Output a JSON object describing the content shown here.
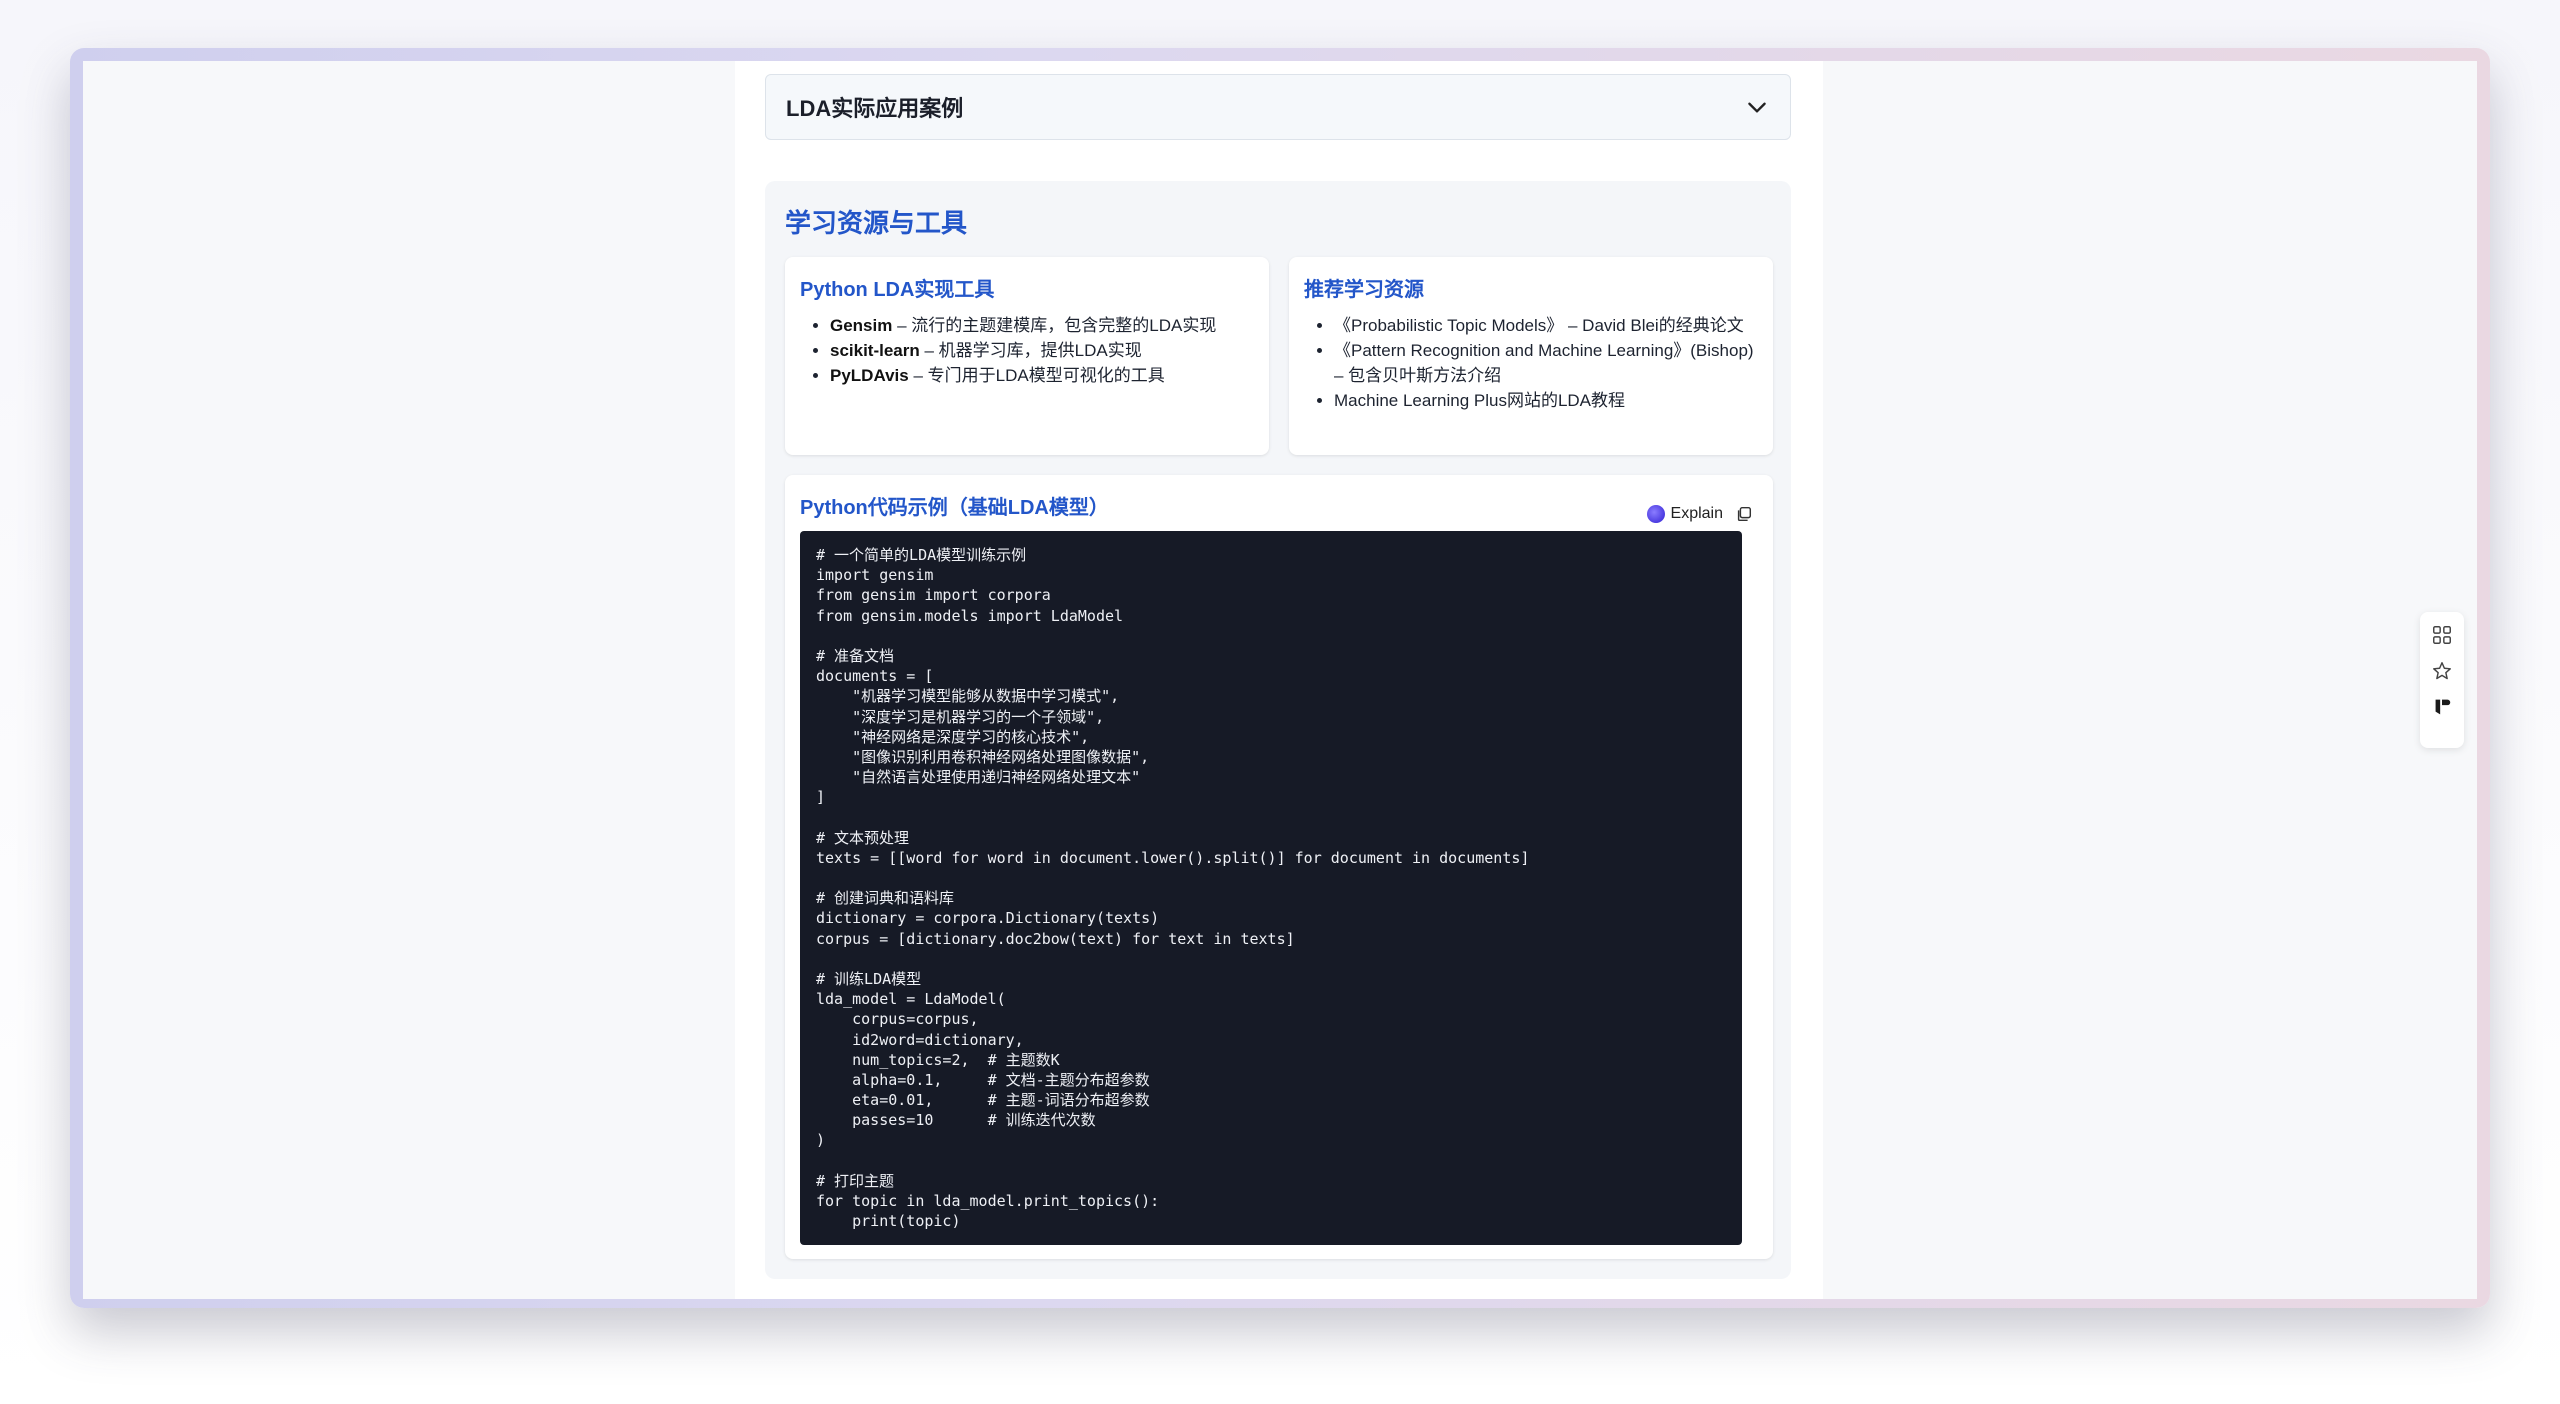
{
  "accordion": {
    "title": "LDA实际应用案例"
  },
  "resources_section": {
    "title": "学习资源与工具",
    "tools_card": {
      "title": "Python LDA实现工具",
      "items": [
        {
          "name": "Gensim",
          "desc": " – 流行的主题建模库，包含完整的LDA实现"
        },
        {
          "name": "scikit-learn",
          "desc": " – 机器学习库，提供LDA实现"
        },
        {
          "name": "PyLDAvis",
          "desc": " – 专门用于LDA模型可视化的工具"
        }
      ]
    },
    "learning_card": {
      "title": "推荐学习资源",
      "items": [
        "《Probabilistic Topic Models》 – David Blei的经典论文",
        "《Pattern Recognition and Machine Learning》(Bishop) – 包含贝叶斯方法介绍",
        "Machine Learning Plus网站的LDA教程"
      ]
    },
    "code_card": {
      "title": "Python代码示例（基础LDA模型）",
      "explain_label": "Explain",
      "icons": [
        "explain-icon",
        "copy-icon"
      ],
      "lines": [
        "# 一个简单的LDA模型训练示例",
        "import gensim",
        "from gensim import corpora",
        "from gensim.models import LdaModel",
        "",
        "# 准备文档",
        "documents = [",
        "    \"机器学习模型能够从数据中学习模式\",",
        "    \"深度学习是机器学习的一个子领域\",",
        "    \"神经网络是深度学习的核心技术\",",
        "    \"图像识别利用卷积神经网络处理图像数据\",",
        "    \"自然语言处理使用递归神经网络处理文本\"",
        "]",
        "",
        "# 文本预处理",
        "texts = [[word for word in document.lower().split()] for document in documents]",
        "",
        "# 创建词典和语料库",
        "dictionary = corpora.Dictionary(texts)",
        "corpus = [dictionary.doc2bow(text) for text in texts]",
        "",
        "# 训练LDA模型",
        "lda_model = LdaModel(",
        "    corpus=corpus,",
        "    id2word=dictionary,",
        "    num_topics=2,  # 主题数K",
        "    alpha=0.1,     # 文档-主题分布超参数",
        "    eta=0.01,      # 主题-词语分布超参数",
        "    passes=10      # 训练迭代次数",
        ")",
        "",
        "# 打印主题",
        "for topic in lda_model.print_topics():",
        "    print(topic)"
      ]
    }
  },
  "side_toolbar": {
    "icons": [
      "grid-icon",
      "star-icon",
      "brand-icon"
    ]
  },
  "colors": {
    "accent": "#2356c9",
    "code_bg": "#161a26",
    "explain_purple": "#4b3be0"
  }
}
